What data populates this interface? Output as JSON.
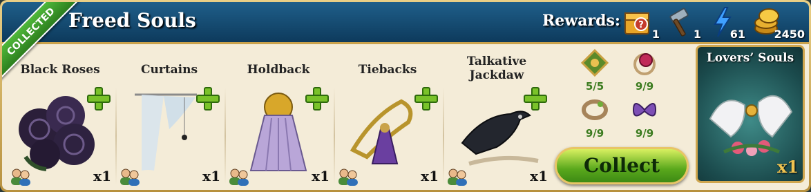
{
  "header": {
    "title": "Freed Souls",
    "rewards_label": "Rewards:"
  },
  "ribbon": {
    "label": "COLLECTED"
  },
  "rewards": [
    {
      "icon": "mystery-chest-icon",
      "count": "1"
    },
    {
      "icon": "hammer-icon",
      "count": "1"
    },
    {
      "icon": "energy-bolt-icon",
      "count": "61"
    },
    {
      "icon": "gold-coins-icon",
      "count": "2450"
    }
  ],
  "items": [
    {
      "name": "Black Roses",
      "qty": "x1"
    },
    {
      "name": "Curtains",
      "qty": "x1"
    },
    {
      "name": "Holdback",
      "qty": "x1"
    },
    {
      "name": "Tiebacks",
      "qty": "x1"
    },
    {
      "name": "Talkative Jackdaw",
      "qty": "x1"
    }
  ],
  "collection_counts": [
    "5/5",
    "9/9",
    "9/9",
    "9/9"
  ],
  "collect_button": {
    "label": "Collect"
  },
  "final_item": {
    "name": "Lovers’ Souls",
    "qty": "x1"
  },
  "colors": {
    "header": "#0d3a5c",
    "accent_gold": "#caa24c",
    "progress_green": "#3a7b1e"
  }
}
